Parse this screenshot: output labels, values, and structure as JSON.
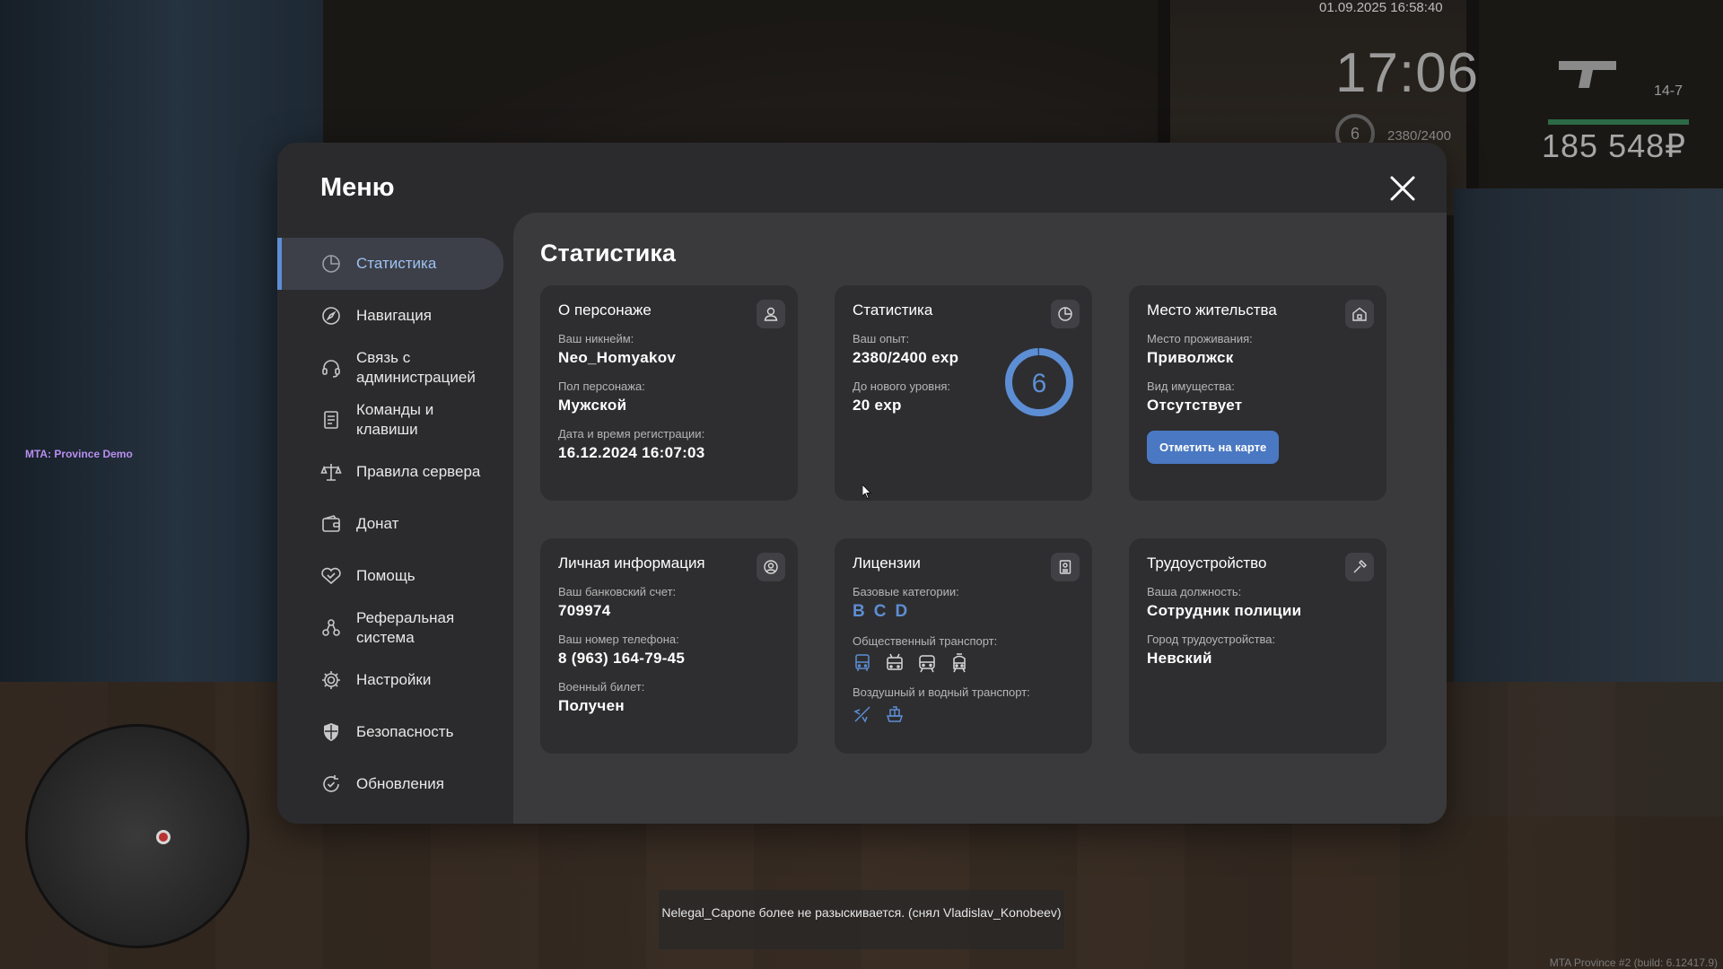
{
  "hud": {
    "datetime": "01.09.2025 16:58:40",
    "clock": "17:06",
    "level": "6",
    "exp": "2380/2400",
    "ammo": "14-7",
    "money": "185 548₽",
    "server_label": "MTA: Province Demo",
    "build": "MTA Province #2 (build: 6.12417.9)",
    "chat_message": "Nelegal_Capone более не разыскивается. (снял Vladislav_Konobeev)"
  },
  "menu": {
    "title": "Меню",
    "close_icon": "close-icon"
  },
  "sidebar": {
    "items": [
      {
        "label": "Статистика",
        "icon": "pie-chart-icon",
        "active": true
      },
      {
        "label": "Навигация",
        "icon": "compass-icon"
      },
      {
        "label": "Связь с администрацией",
        "icon": "headset-icon"
      },
      {
        "label": "Команды и клавиши",
        "icon": "document-icon"
      },
      {
        "label": "Правила сервера",
        "icon": "scales-icon"
      },
      {
        "label": "Донат",
        "icon": "wallet-icon"
      },
      {
        "label": "Помощь",
        "icon": "handshake-icon"
      },
      {
        "label": "Реферальная система",
        "icon": "referral-icon"
      },
      {
        "label": "Настройки",
        "icon": "gear-icon"
      },
      {
        "label": "Безопасность",
        "icon": "shield-icon"
      },
      {
        "label": "Обновления",
        "icon": "refresh-icon"
      }
    ]
  },
  "main": {
    "title": "Статистика",
    "character": {
      "title": "О персонаже",
      "nickname_label": "Ваш никнейм:",
      "nickname": "Neo_Homyakov",
      "gender_label": "Пол персонажа:",
      "gender": "Мужской",
      "reg_label": "Дата и время регистрации:",
      "reg_date": "16.12.2024 16:07:03"
    },
    "stats": {
      "title": "Статистика",
      "exp_label": "Ваш опыт:",
      "exp": "2380/2400 exp",
      "next_label": "До нового уровня:",
      "next": "20 exp",
      "level": "6",
      "progress_fraction": 0.9917
    },
    "residence": {
      "title": "Место жительства",
      "place_label": "Место проживания:",
      "place": "Приволжск",
      "property_label": "Вид имущества:",
      "property": "Отсутствует",
      "map_button": "Отметить на карте"
    },
    "personal": {
      "title": "Личная информация",
      "bank_label": "Ваш банковский счет:",
      "bank": "709974",
      "phone_label": "Ваш номер телефона:",
      "phone": "8 (963) 164-79-45",
      "military_label": "Военный билет:",
      "military": "Получен"
    },
    "licenses": {
      "title": "Лицензии",
      "base_label": "Базовые категории:",
      "categories": [
        "B",
        "C",
        "D"
      ],
      "public_label": "Общественный транспорт:",
      "public_icons": [
        "bus-icon",
        "trolleybus-icon",
        "train-icon",
        "tram-icon"
      ],
      "air_label": "Воздушный и водный транспорт:",
      "air_icons": [
        "plane-icon",
        "ship-icon"
      ]
    },
    "job": {
      "title": "Трудоустройство",
      "position_label": "Ваша должность:",
      "position": "Сотрудник полиции",
      "city_label": "Город трудоустройства:",
      "city": "Невский"
    }
  },
  "colors": {
    "accent": "#5d8ed4",
    "button": "#4a78c2",
    "panel": "#2b2b2d",
    "card": "#2e2e30"
  }
}
